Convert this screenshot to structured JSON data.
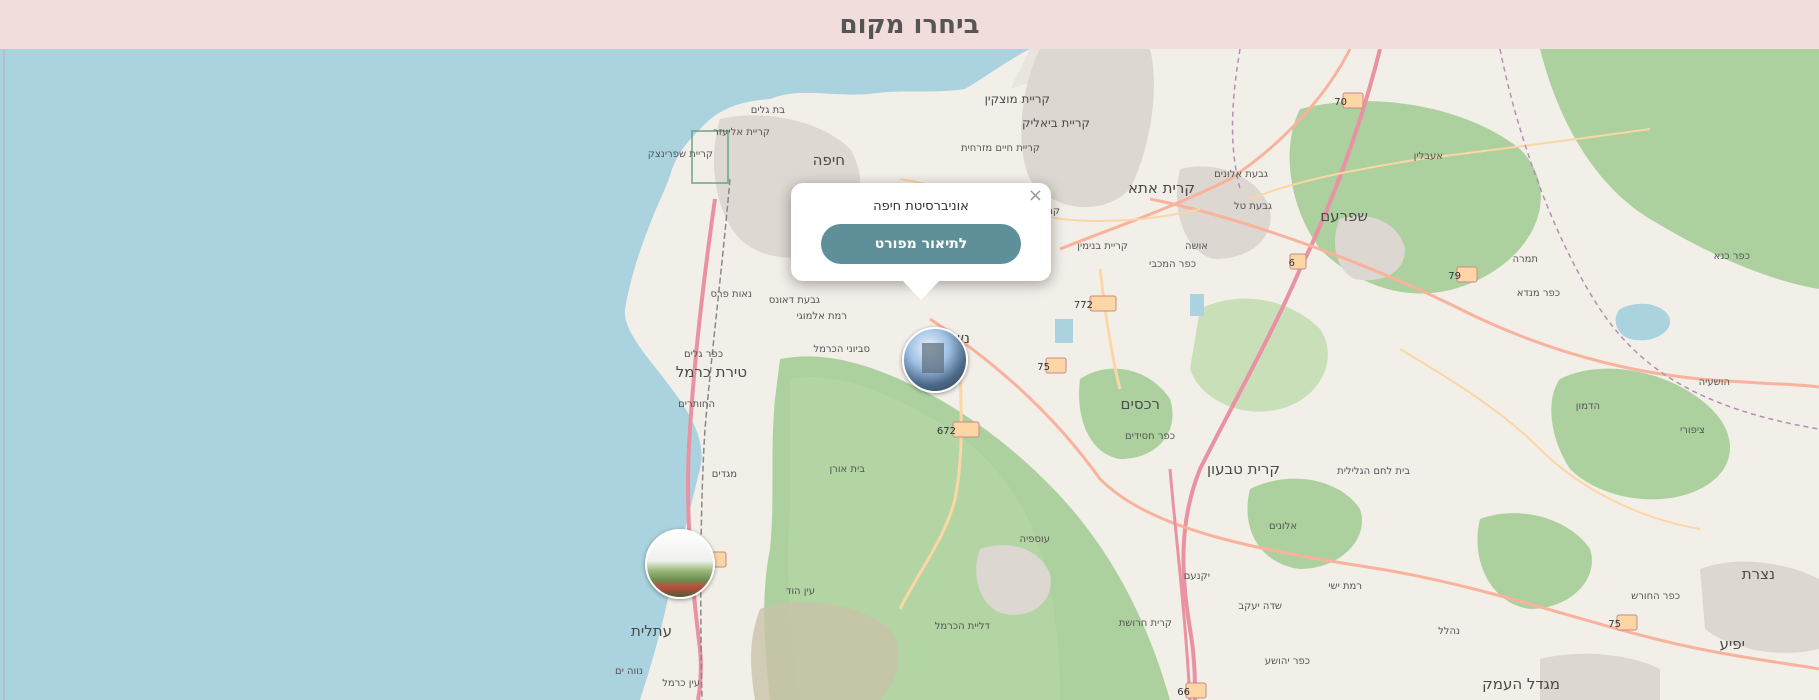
{
  "header": {
    "title": "ביחרו מקום"
  },
  "popup": {
    "title": "אוניברסיטת חיפה",
    "button_label": "לתיאור מפורט",
    "close_glyph": "×"
  },
  "markers": [
    {
      "name": "haifa-university-marker",
      "label": "אוניברסיטת חיפה"
    },
    {
      "name": "atlit-marker"
    }
  ],
  "map_labels": {
    "haifa": "חיפה",
    "kiryat_motzkin": "קריית מוצקין",
    "kiryat_bialik": "קריית ביאליק",
    "kiryat_ata": "קרית אתא",
    "nesher": "נשר",
    "tirat_carmel": "טירת כרמל",
    "shfaram": "שפרעם",
    "rechasim": "רכסים",
    "kiryat_tivon": "קרית טבעון",
    "atlit": "עתלית",
    "migdal_haemek": "מגדל העמק",
    "yafa_an_naseriyye": "יפיע",
    "nazareth": "נצרת",
    "bat_galim": "בת גלים",
    "kiryat_eliezer": "קריית אליעזר",
    "kiryat_sprinzak": "קריית שפרינצק",
    "kiryat_haim": "קריית חיים מזרחית",
    "kiryat_nahum": "קריית נחום",
    "givat_daunes": "גבעת דאונס",
    "ramat_almogi": "רמת אלמוגי",
    "svivei_carmel": "סביוני הכרמל",
    "neve_paz": "נאות פרס",
    "kfar_galim": "כפר גלים",
    "hahotrim": "החותרים",
    "megadim": "מגדים",
    "beit_oren": "בית אורן",
    "isfiya": "עוספיה",
    "daliat": "דליית הכרמל",
    "ein_hod": "עין הוד",
    "neve_yam": "נווה ים",
    "ein_carmel": "עין כרמל",
    "usha": "אושה",
    "kfar_hamaccabi": "כפר המכבי",
    "kiryat_binyamin": "קריית בנימין",
    "givat_tal": "גבעת טל",
    "givat_alonim": "גבעת אלונים",
    "alonim": "אלונים",
    "kfar_hasidim": "כפר חסידים",
    "kfar_yehoshua": "כפר יהושע",
    "yokneam": "יקנעם",
    "ibillin": "אעבלין",
    "shefar_amr": "שפרעם",
    "kiryat_haroshet": "קרית חרושת",
    "beit_lehem": "בית לחם הגלילית",
    "hoshaya": "הושעיה",
    "zippori": "ציפורי",
    "nahalal": "נהלל",
    "ramat_yishai": "רמת ישי",
    "sde_yaakov": "שדה יעקב",
    "tamra": "תמרה",
    "kfar_kana": "כפר כנא",
    "kafr_manda": "כפר מנדא",
    "hadamon": "הדמון",
    "kfar_hahoresh": "כפר החורש"
  },
  "roads": [
    "70",
    "6",
    "79",
    "772",
    "75",
    "672",
    "2",
    "66",
    "75"
  ]
}
